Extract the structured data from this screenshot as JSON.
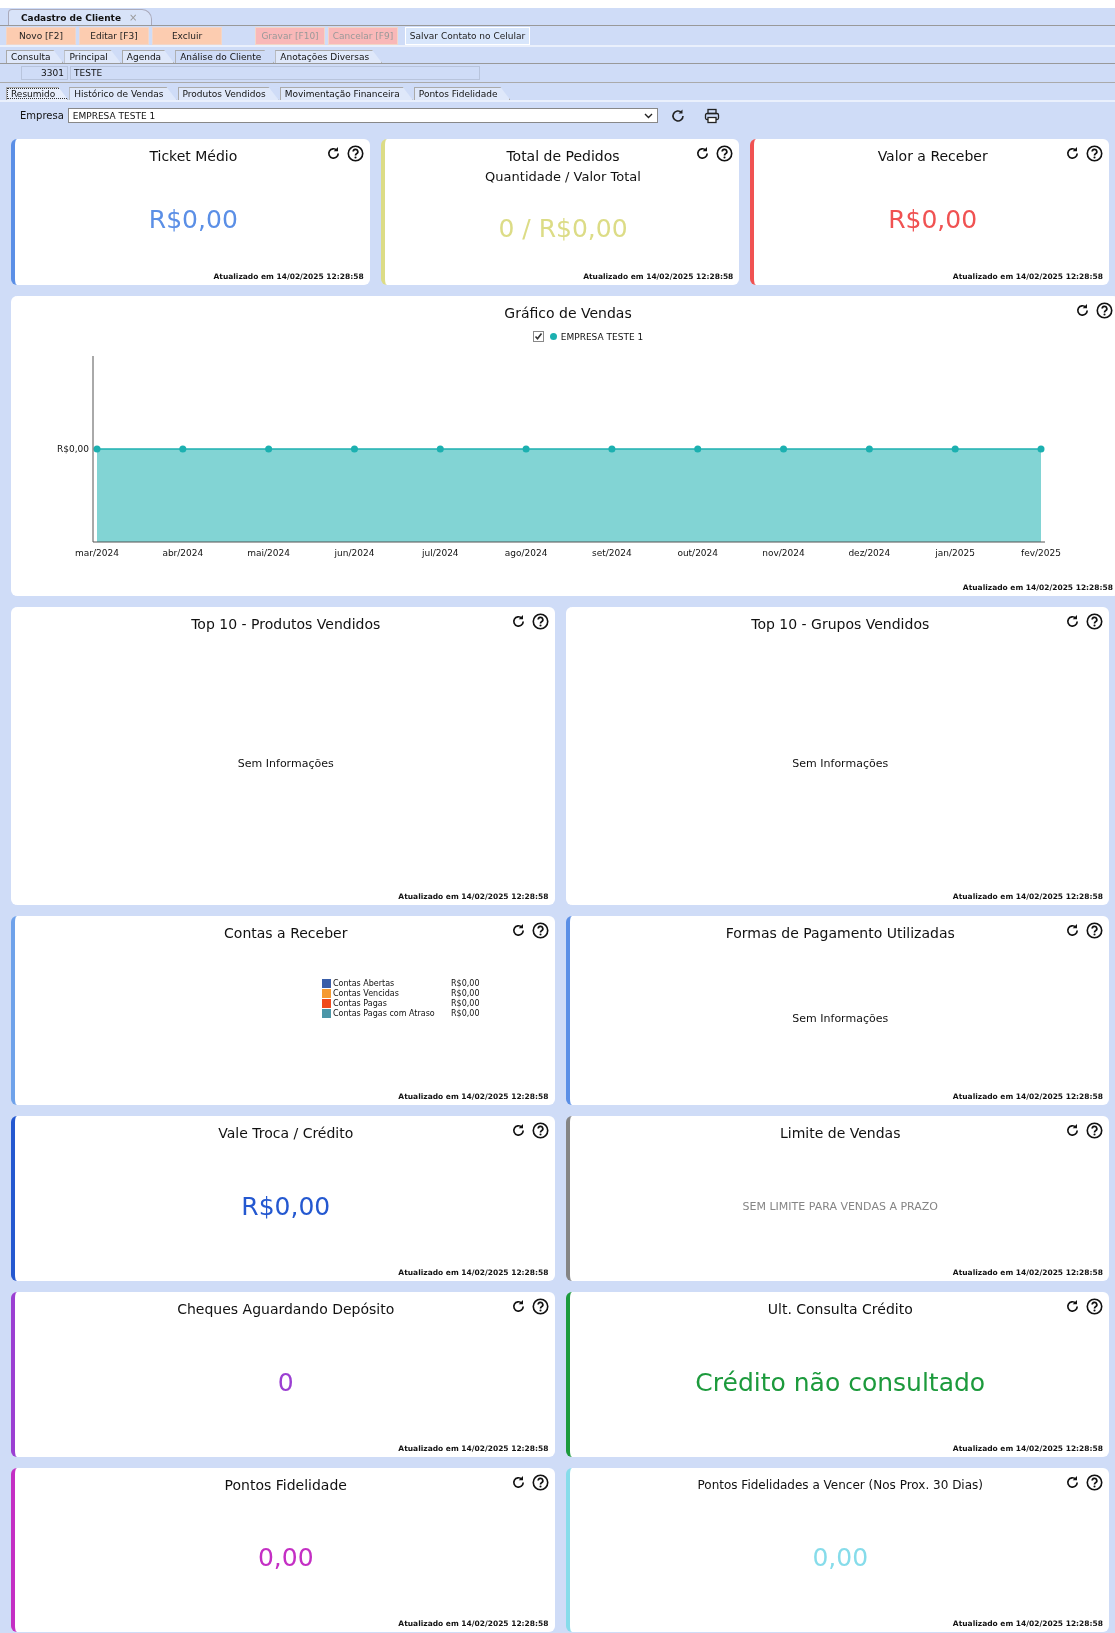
{
  "window": {
    "title": "Cadastro de Cliente",
    "close_glyph": "×"
  },
  "toolbar": [
    {
      "label": "Novo [F2]",
      "kind": "action",
      "disabled": false
    },
    {
      "label": "Editar [F3]",
      "kind": "action",
      "disabled": false
    },
    {
      "label": "Excluir",
      "kind": "action",
      "disabled": false
    },
    {
      "label": "Gravar [F10]",
      "kind": "action",
      "disabled": true
    },
    {
      "label": "Cancelar [F9]",
      "kind": "action",
      "disabled": true
    },
    {
      "label": "Salvar Contato no Celular",
      "kind": "secondary",
      "disabled": false
    }
  ],
  "tabs": [
    {
      "label": "Consulta",
      "selected": false
    },
    {
      "label": "Principal",
      "selected": false
    },
    {
      "label": "Agenda",
      "selected": false
    },
    {
      "label": "Análise do Cliente",
      "selected": true
    },
    {
      "label": "Anotações Diversas",
      "selected": false
    }
  ],
  "client": {
    "code": "3301",
    "name": "TESTE"
  },
  "subtabs": [
    {
      "label": "Resumido",
      "selected": true
    },
    {
      "label": "Histórico de Vendas",
      "selected": false
    },
    {
      "label": "Produtos Vendidos",
      "selected": false
    },
    {
      "label": "Movimentação Financeira",
      "selected": false
    },
    {
      "label": "Pontos Fidelidade",
      "selected": false
    }
  ],
  "empresa": {
    "label": "Empresa",
    "value": "EMPRESA TESTE 1"
  },
  "rows": [
    [
      {
        "kind": "value",
        "title": "Ticket Médio",
        "value": "R$0,00",
        "color": "#5b8fe6",
        "updated": "Atualizado em 14/02/2025 12:28:58"
      },
      {
        "kind": "value",
        "title": "Total de Pedidos",
        "subtitle": "Quantidade / Valor Total",
        "value": "0 / R$0,00",
        "color": "#dcdc86",
        "updated": "Atualizado em 14/02/2025 12:28:58"
      },
      {
        "kind": "value",
        "title": "Valor a Receber",
        "value": "R$0,00",
        "color": "#f05252",
        "updated": "Atualizado em 14/02/2025 12:28:58"
      }
    ],
    [
      {
        "kind": "chart",
        "title": "Gráfico de Vendas",
        "legend_checked": true,
        "updated": "Atualizado em 14/02/2025 12:28:58",
        "legend_name": "EMPRESA TESTE 1",
        "y_label": "R$0,00",
        "x_labels": [
          "mar/2024",
          "abr/2024",
          "mai/2024",
          "jun/2024",
          "jul/2024",
          "ago/2024",
          "set/2024",
          "out/2024",
          "nov/2024",
          "dez/2024",
          "jan/2025",
          "fev/2025"
        ]
      }
    ],
    [
      {
        "kind": "text",
        "title": "Top 10 - Produtos Vendidos",
        "value": "Sem Informações",
        "updated": "Atualizado em 14/02/2025 12:28:58"
      },
      {
        "kind": "text",
        "title": "Top 10 - Grupos Vendidos",
        "value": "Sem Informações",
        "updated": "Atualizado em 14/02/2025 12:28:58"
      }
    ],
    [
      {
        "kind": "legend",
        "title": "Contas a Receber",
        "color": "#6fa2ea",
        "updated": "Atualizado em 14/02/2025 12:28:58",
        "legend": [
          {
            "name": "Contas Abertas",
            "value": "R$0,00",
            "color": "#3a5ea8"
          },
          {
            "name": "Contas Vencidas",
            "value": "R$0,00",
            "color": "#f59a30"
          },
          {
            "name": "Contas Pagas",
            "value": "R$0,00",
            "color": "#f04a1a"
          },
          {
            "name": "Contas Pagas com Atraso",
            "value": "R$0,00",
            "color": "#4a96a8"
          }
        ]
      },
      {
        "kind": "text",
        "title": "Formas de Pagamento Utilizadas",
        "value": "Sem Informações",
        "color": "#5b8fe6",
        "updated": "Atualizado em 14/02/2025 12:28:58"
      }
    ],
    [
      {
        "kind": "value",
        "title": "Vale Troca / Crédito",
        "value": "R$0,00",
        "color": "#2458d0",
        "updated": "Atualizado em 14/02/2025 12:28:58"
      },
      {
        "kind": "note",
        "title": "Limite de Vendas",
        "value": "SEM LIMITE PARA VENDAS A PRAZO",
        "color": "#858585",
        "updated": "Atualizado em 14/02/2025 12:28:58"
      }
    ],
    [
      {
        "kind": "value",
        "title": "Cheques Aguardando Depósito",
        "value": "0",
        "color": "#9b3fd2",
        "updated": "Atualizado em 14/02/2025 12:28:58"
      },
      {
        "kind": "value",
        "title": "Ult. Consulta Crédito",
        "value": "Crédito não consultado",
        "color": "#1c9a3c",
        "updated": "Atualizado em 14/02/2025 12:28:58"
      }
    ],
    [
      {
        "kind": "value",
        "title": "Pontos Fidelidade",
        "value": "0,00",
        "color": "#c42fc4",
        "updated": "Atualizado em 14/02/2025 12:28:58"
      },
      {
        "kind": "value",
        "title": "Pontos Fidelidades a Vencer (Nos Prox. 30 Dias)",
        "small_title": true,
        "value": "0,00",
        "color": "#86dcea",
        "updated": "Atualizado em 14/02/2025 12:28:58"
      }
    ]
  ]
}
